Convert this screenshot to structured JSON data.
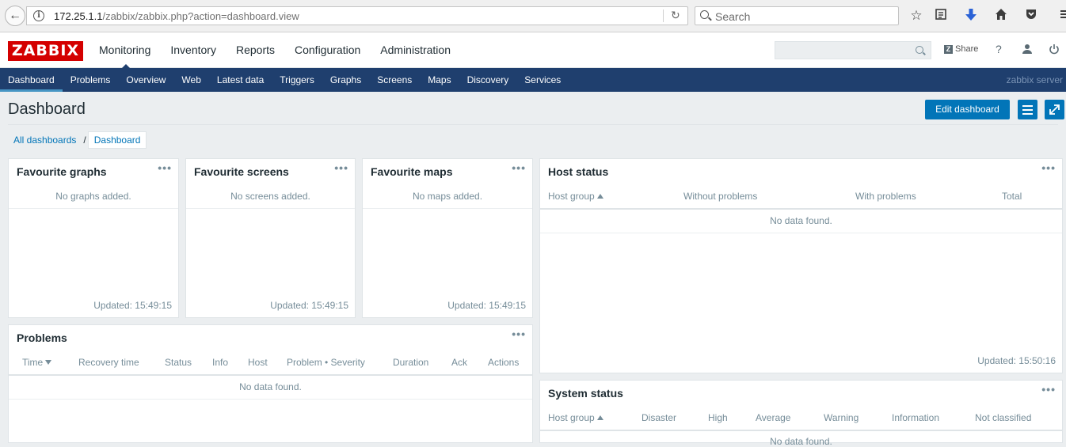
{
  "browser": {
    "url_host": "172.25.1.1",
    "url_path": "/zabbix/zabbix.php?action=dashboard.view",
    "search_placeholder": "Search"
  },
  "header": {
    "logo": "ZABBIX",
    "main_menu": [
      "Monitoring",
      "Inventory",
      "Reports",
      "Configuration",
      "Administration"
    ],
    "share_label": "Share",
    "help_label": "?"
  },
  "sub_menu": {
    "items": [
      "Dashboard",
      "Problems",
      "Overview",
      "Web",
      "Latest data",
      "Triggers",
      "Graphs",
      "Screens",
      "Maps",
      "Discovery",
      "Services"
    ],
    "server_name": "zabbix server"
  },
  "page": {
    "title": "Dashboard",
    "edit_button": "Edit dashboard",
    "breadcrumb": [
      "All dashboards",
      "Dashboard"
    ],
    "breadcrumb_sep": "/"
  },
  "widgets": {
    "favourite_graphs": {
      "title": "Favourite graphs",
      "empty": "No graphs added.",
      "updated": "Updated: 15:49:15"
    },
    "favourite_screens": {
      "title": "Favourite screens",
      "empty": "No screens added.",
      "updated": "Updated: 15:49:15"
    },
    "favourite_maps": {
      "title": "Favourite maps",
      "empty": "No maps added.",
      "updated": "Updated: 15:49:15"
    },
    "host_status": {
      "title": "Host status",
      "columns": [
        "Host group",
        "Without problems",
        "With problems",
        "Total"
      ],
      "empty": "No data found.",
      "updated": "Updated: 15:50:16"
    },
    "problems": {
      "title": "Problems",
      "columns": [
        "Time",
        "Recovery time",
        "Status",
        "Info",
        "Host",
        "Problem • Severity",
        "Duration",
        "Ack",
        "Actions"
      ],
      "empty": "No data found."
    },
    "system_status": {
      "title": "System status",
      "columns": [
        "Host group",
        "Disaster",
        "High",
        "Average",
        "Warning",
        "Information",
        "Not classified"
      ],
      "empty": "No data found."
    },
    "menu_dots": "•••"
  }
}
